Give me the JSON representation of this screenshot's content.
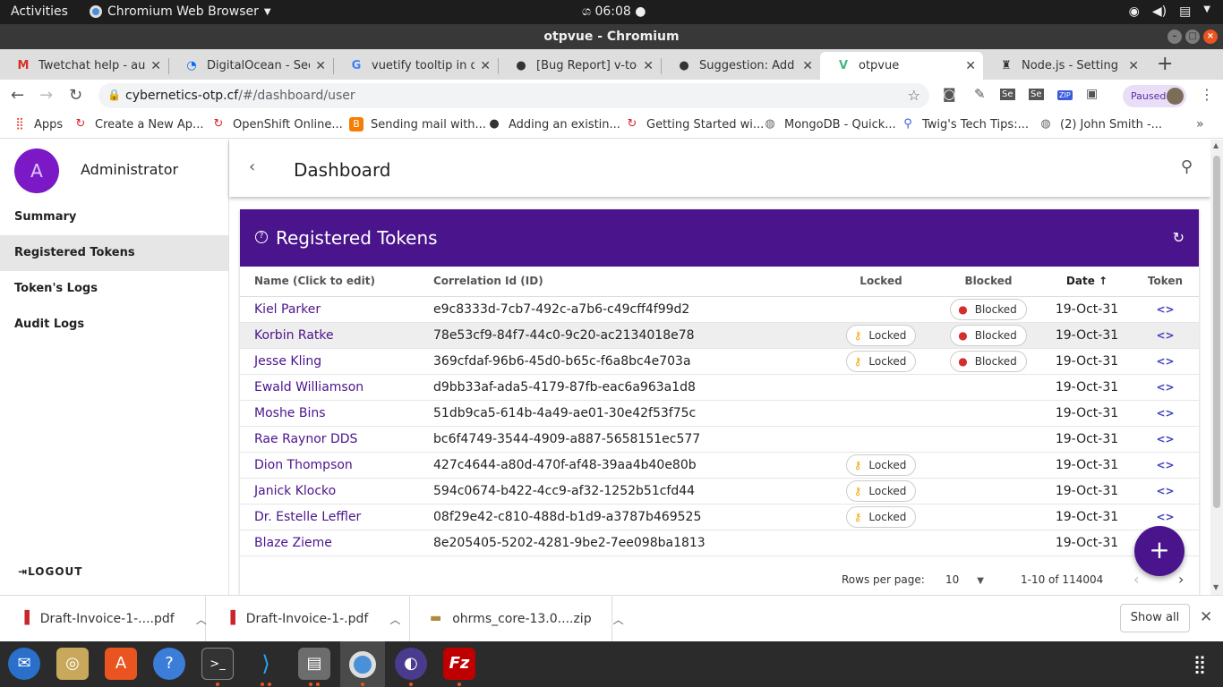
{
  "topbar": {
    "activities": "Activities",
    "app_name": "Chromium Web Browser",
    "clock": "ශ 06:08 ●"
  },
  "window": {
    "title": "otpvue - Chromium"
  },
  "tabs": [
    {
      "label": "Twetchat help - aung",
      "icon": "gmail-icon"
    },
    {
      "label": "DigitalOcean - Secur",
      "icon": "digitalocean-icon"
    },
    {
      "label": "vuetify tooltip in dial",
      "icon": "google-icon"
    },
    {
      "label": "[Bug Report] v-toolti",
      "icon": "github-icon"
    },
    {
      "label": "Suggestion: Add a p",
      "icon": "github-icon"
    },
    {
      "label": "otpvue",
      "icon": "vue-icon",
      "active": true
    },
    {
      "label": "Node.js - Setting NC",
      "icon": "node-icon"
    }
  ],
  "toolbar": {
    "url_host": "cybernetics-otp.cf",
    "url_path": "/#/dashboard/user",
    "profile_label": "Paused"
  },
  "bookmarks": [
    {
      "label": "Apps"
    },
    {
      "label": "Create a New Ap..."
    },
    {
      "label": "OpenShift Online..."
    },
    {
      "label": "Sending mail with..."
    },
    {
      "label": "Adding an existin..."
    },
    {
      "label": "Getting Started wi..."
    },
    {
      "label": "MongoDB - Quick..."
    },
    {
      "label": "Twig's Tech Tips:..."
    },
    {
      "label": "(2) John Smith -..."
    }
  ],
  "sidebar": {
    "avatar_letter": "A",
    "username": "Administrator",
    "items": [
      {
        "label": "Summary"
      },
      {
        "label": "Registered Tokens",
        "active": true
      },
      {
        "label": "Token's Logs"
      },
      {
        "label": "Audit Logs"
      }
    ],
    "logout": "LOGOUT"
  },
  "appbar": {
    "title": "Dashboard"
  },
  "card": {
    "title": "Registered Tokens",
    "columns": [
      "Name (Click to edit)",
      "Correlation Id (ID)",
      "Locked",
      "Blocked",
      "Date",
      "Token"
    ],
    "rows": [
      {
        "name": "Kiel Parker",
        "id": "e9c8333d-7cb7-492c-a7b6-c49cff4f99d2",
        "locked": "",
        "blocked": "Blocked",
        "date": "19-Oct-31"
      },
      {
        "name": "Korbin Ratke",
        "id": "78e53cf9-84f7-44c0-9c20-ac2134018e78",
        "locked": "Locked",
        "blocked": "Blocked",
        "date": "19-Oct-31"
      },
      {
        "name": "Jesse Kling",
        "id": "369cfdaf-96b6-45d0-b65c-f6a8bc4e703a",
        "locked": "Locked",
        "blocked": "Blocked",
        "date": "19-Oct-31"
      },
      {
        "name": "Ewald Williamson",
        "id": "d9bb33af-ada5-4179-87fb-eac6a963a1d8",
        "locked": "",
        "blocked": "",
        "date": "19-Oct-31"
      },
      {
        "name": "Moshe Bins",
        "id": "51db9ca5-614b-4a49-ae01-30e42f53f75c",
        "locked": "",
        "blocked": "",
        "date": "19-Oct-31"
      },
      {
        "name": "Rae Raynor DDS",
        "id": "bc6f4749-3544-4909-a887-5658151ec577",
        "locked": "",
        "blocked": "",
        "date": "19-Oct-31"
      },
      {
        "name": "Dion Thompson",
        "id": "427c4644-a80d-470f-af48-39aa4b40e80b",
        "locked": "Locked",
        "blocked": "",
        "date": "19-Oct-31"
      },
      {
        "name": "Janick Klocko",
        "id": "594c0674-b422-4cc9-af32-1252b51cfd44",
        "locked": "Locked",
        "blocked": "",
        "date": "19-Oct-31"
      },
      {
        "name": "Dr. Estelle Leffler",
        "id": "08f29e42-c810-488d-b1d9-a3787b469525",
        "locked": "Locked",
        "blocked": "",
        "date": "19-Oct-31"
      },
      {
        "name": "Blaze Zieme",
        "id": "8e205405-5202-4281-9be2-7ee098ba1813",
        "locked": "",
        "blocked": "",
        "date": "19-Oct-31"
      }
    ],
    "token_symbol": "<>",
    "rows_per_page_label": "Rows per page:",
    "rows_per_page_value": "10",
    "page_range": "1-10 of 114004"
  },
  "downloads": [
    {
      "name": "Draft-Invoice-1-....pdf"
    },
    {
      "name": "Draft-Invoice-1-.pdf"
    },
    {
      "name": "ohrms_core-13.0....zip"
    }
  ],
  "download_show_all": "Show all",
  "colors": {
    "primary": "#4a148c",
    "avatar": "#7b19c6",
    "lock_key": "#f5a300",
    "blocked_person": "#d32f2f"
  }
}
